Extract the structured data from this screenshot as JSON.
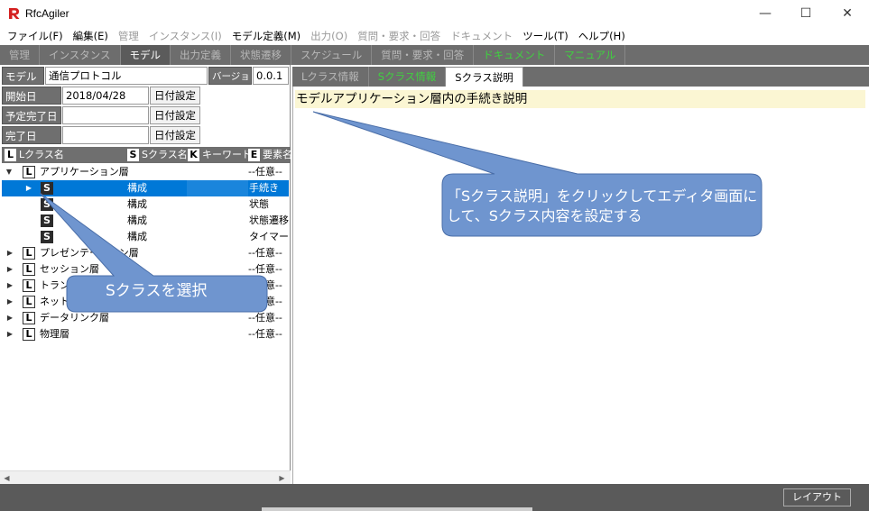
{
  "window": {
    "title": "RfcAgiler",
    "min_glyph": "—",
    "max_glyph": "☐",
    "close_glyph": "✕"
  },
  "menubar": [
    {
      "label": "ファイル(F)",
      "enabled": true
    },
    {
      "label": "編集(E)",
      "enabled": true
    },
    {
      "label": "管理",
      "enabled": false
    },
    {
      "label": "インスタンス(I)",
      "enabled": false
    },
    {
      "label": "モデル定義(M)",
      "enabled": true
    },
    {
      "label": "出力(O)",
      "enabled": false
    },
    {
      "label": "質問・要求・回答",
      "enabled": false
    },
    {
      "label": "ドキュメント",
      "enabled": false
    },
    {
      "label": "ツール(T)",
      "enabled": true
    },
    {
      "label": "ヘルプ(H)",
      "enabled": true
    }
  ],
  "toptabs": [
    {
      "label": "管理",
      "state": "normal"
    },
    {
      "label": "インスタンス",
      "state": "normal"
    },
    {
      "label": "モデル",
      "state": "active"
    },
    {
      "label": "出力定義",
      "state": "normal"
    },
    {
      "label": "状態遷移",
      "state": "normal"
    },
    {
      "label": "スケジュール",
      "state": "normal"
    },
    {
      "label": "質問・要求・回答",
      "state": "normal"
    },
    {
      "label": "ドキュメント",
      "state": "green"
    },
    {
      "label": "マニュアル",
      "state": "green"
    }
  ],
  "model_form": {
    "model_name_label": "モデル名",
    "model_name_value": "通信プロトコル",
    "version_label": "バージョン",
    "version_value": "0.0.1",
    "start_label": "開始日",
    "start_value": "2018/04/28",
    "planned_end_label": "予定完了日",
    "planned_end_value": "",
    "end_label": "完了日",
    "end_value": "",
    "date_button_label": "日付設定"
  },
  "tree_header": {
    "l_badge": "L",
    "l_text": "Lクラス名",
    "s_badge": "S",
    "s_text": "Sクラス名",
    "k_badge": "K",
    "k_text": "キーワード",
    "e_badge": "E",
    "e_text": "要素名"
  },
  "tree": [
    {
      "kind": "L",
      "expanded": true,
      "name": "アプリケーション層",
      "col": "",
      "right": "--任意--",
      "selected": false
    },
    {
      "kind": "S",
      "name": "",
      "col": "構成",
      "right": "手続き",
      "selected": true
    },
    {
      "kind": "S",
      "name": "",
      "col": "構成",
      "right": "状態",
      "selected": false
    },
    {
      "kind": "S",
      "name": "",
      "col": "構成",
      "right": "状態遷移",
      "selected": false
    },
    {
      "kind": "S",
      "name": "",
      "col": "構成",
      "right": "タイマー",
      "selected": false
    },
    {
      "kind": "L",
      "expanded": false,
      "name": "プレゼンテーション層",
      "col": "",
      "right": "--任意--",
      "selected": false
    },
    {
      "kind": "L",
      "expanded": false,
      "name": "セッション層",
      "col": "",
      "right": "--任意--",
      "selected": false
    },
    {
      "kind": "L",
      "expanded": false,
      "name": "トランスポート層",
      "col": "",
      "right": "--任意--",
      "selected": false
    },
    {
      "kind": "L",
      "expanded": false,
      "name": "ネットワーク層",
      "col": "",
      "right": "--任意--",
      "selected": false
    },
    {
      "kind": "L",
      "expanded": false,
      "name": "データリンク層",
      "col": "",
      "right": "--任意--",
      "selected": false
    },
    {
      "kind": "L",
      "expanded": false,
      "name": "物理層",
      "col": "",
      "right": "--任意--",
      "selected": false
    }
  ],
  "arrows": {
    "expanded": "▼",
    "collapsed": "▶",
    "scroll_left": "◀",
    "scroll_right": "▶"
  },
  "right_tabs": [
    {
      "label": "Lクラス情報",
      "state": "normal"
    },
    {
      "label": "Sクラス情報",
      "state": "green"
    },
    {
      "label": "Sクラス説明",
      "state": "active"
    }
  ],
  "editor": {
    "first_line": "モデルアプリケーション層内の手続き説明"
  },
  "statusbar": {
    "layout_button": "レイアウト"
  },
  "callouts": {
    "left_text": "Sクラスを選択",
    "right_line1": "「Sクラス説明」をクリックしてエディタ画面に",
    "right_line2": "して、Sクラス内容を設定する",
    "fill": "#6f95cf",
    "stroke": "#4a6ea8"
  },
  "colors": {
    "selection": "#0078d7",
    "toolbar_gray": "#6d6d6d",
    "editor_highlight": "#fbf6d3",
    "logo_red": "#d42020"
  }
}
